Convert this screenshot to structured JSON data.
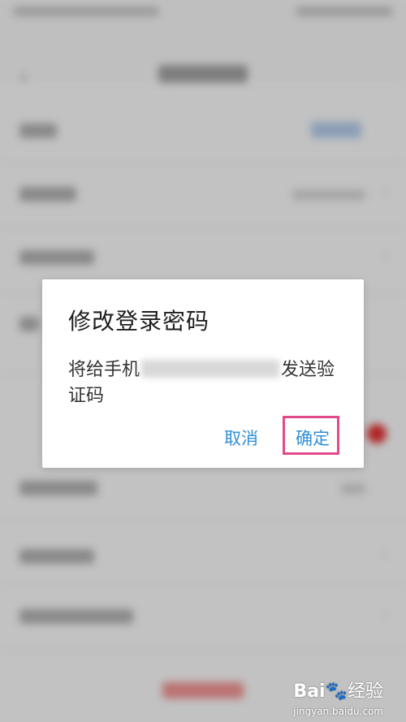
{
  "dialog": {
    "title": "修改登录密码",
    "message_prefix": "将给手机",
    "message_suffix": "发送验",
    "message_line2": "证码",
    "cancel_label": "取消",
    "confirm_label": "确定"
  },
  "background": {
    "back_icon": "chevron-left-icon",
    "section_hint": "抖"
  },
  "colors": {
    "accent": "#2f8fd8",
    "highlight_border": "#e24a8b",
    "badge_red": "#d62c2c"
  },
  "watermark": {
    "brand": "Bai",
    "brand_suffix": "经验",
    "domain": "jingyan.baidu.com"
  }
}
